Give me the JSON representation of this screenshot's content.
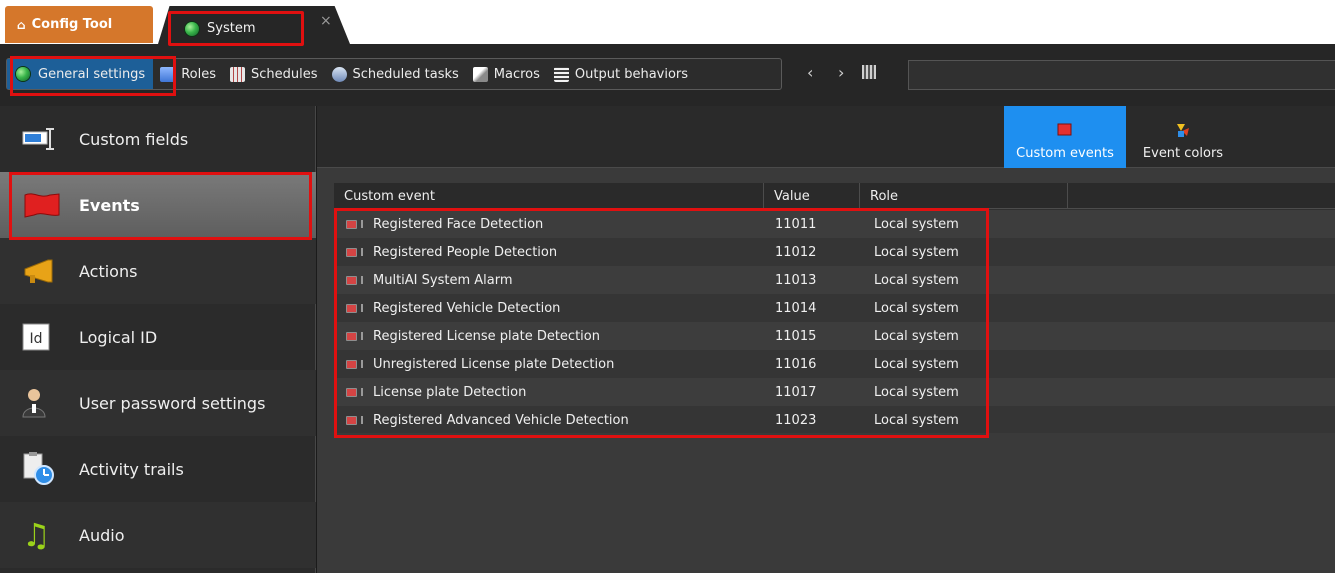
{
  "tabs": {
    "home_label": "Config Tool",
    "system_label": "System",
    "close_glyph": "×"
  },
  "toolbar": {
    "items": [
      {
        "label": "General settings",
        "icon": "globe-icon"
      },
      {
        "label": "Roles",
        "icon": "roles-icon"
      },
      {
        "label": "Schedules",
        "icon": "calendar-icon"
      },
      {
        "label": "Scheduled tasks",
        "icon": "scheduled-task-icon"
      },
      {
        "label": "Macros",
        "icon": "macro-icon"
      },
      {
        "label": "Output behaviors",
        "icon": "output-icon"
      }
    ],
    "back_glyph": "‹",
    "forward_glyph": "›",
    "search_placeholder": ""
  },
  "sidebar": {
    "items": [
      {
        "label": "Custom fields",
        "icon": "custom-fields-icon"
      },
      {
        "label": "Events",
        "icon": "red-flag-icon",
        "active": true
      },
      {
        "label": "Actions",
        "icon": "megaphone-icon"
      },
      {
        "label": "Logical ID",
        "icon": "id-icon",
        "glyph": "Id"
      },
      {
        "label": "User password settings",
        "icon": "user-icon"
      },
      {
        "label": "Activity trails",
        "icon": "activity-trails-icon"
      },
      {
        "label": "Audio",
        "icon": "music-note-icon",
        "glyph": "♫"
      }
    ]
  },
  "content": {
    "header_buttons": [
      {
        "label": "Custom events",
        "icon": "flag-icon",
        "active": true
      },
      {
        "label": "Event colors",
        "icon": "palette-icon"
      }
    ],
    "table": {
      "columns": [
        "Custom event",
        "Value",
        "Role"
      ],
      "rows": [
        {
          "event": "Registered Face Detection",
          "value": "11011",
          "role": "Local system"
        },
        {
          "event": "Registered People Detection",
          "value": "11012",
          "role": "Local system"
        },
        {
          "event": "MultiAI System Alarm",
          "value": "11013",
          "role": "Local system"
        },
        {
          "event": "Registered Vehicle Detection",
          "value": "11014",
          "role": "Local system"
        },
        {
          "event": "Registered License plate Detection",
          "value": "11015",
          "role": "Local system"
        },
        {
          "event": "Unregistered License plate Detection",
          "value": "11016",
          "role": "Local system"
        },
        {
          "event": "License plate Detection",
          "value": "11017",
          "role": "Local system"
        },
        {
          "event": "Registered Advanced Vehicle Detection",
          "value": "11023",
          "role": "Local system"
        }
      ]
    }
  },
  "colors": {
    "accent_orange": "#d5772b",
    "selection_blue": "#1e8ff0",
    "highlight_red": "#e01010",
    "toolbar_active": "#1d5f98"
  }
}
